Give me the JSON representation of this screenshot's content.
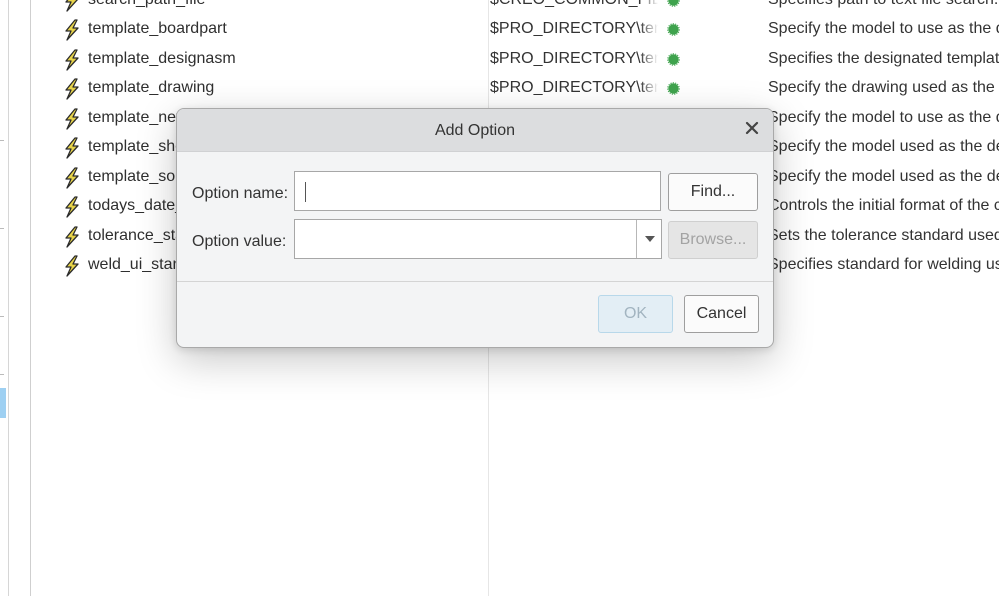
{
  "options_list": {
    "rows": [
      {
        "name": "search_path_file",
        "value": "$CREO_COMMON_FILES",
        "description": "Specifies path to text file search.p"
      },
      {
        "name": "template_boardpart",
        "value": "$PRO_DIRECTORY\\templ",
        "description": "Specify the model to use as the d"
      },
      {
        "name": "template_designasm",
        "value": "$PRO_DIRECTORY\\templ",
        "description": "Specifies the designated template"
      },
      {
        "name": "template_drawing",
        "value": "$PRO_DIRECTORY\\templ",
        "description": "Specify the drawing used as the d"
      },
      {
        "name": "template_new",
        "value": "",
        "description": "Specify the model to use as the d"
      },
      {
        "name": "template_she",
        "value": "",
        "description": "Specify the model used as the def"
      },
      {
        "name": "template_soli",
        "value": "",
        "description": "Specify the model used as the def"
      },
      {
        "name": "todays_date_",
        "value": "",
        "description": "Controls the initial format of the c"
      },
      {
        "name": "tolerance_sta",
        "value": "",
        "description": "Sets the tolerance standard used v"
      },
      {
        "name": "weld_ui_stanc",
        "value": "",
        "description": "Specifies standard for welding use"
      }
    ],
    "row_icon": "lightning-bolt-icon",
    "status_icon": "green-status-dot-icon",
    "status_color": "#3fa34d",
    "icon_color": "#e8d44a"
  },
  "dialog": {
    "title": "Add Option",
    "close_icon": "close-icon",
    "option_name_label": "Option name:",
    "option_name_value": "",
    "option_value_label": "Option value:",
    "option_value_value": "",
    "find_button": "Find...",
    "browse_button": "Browse...",
    "ok_button": "OK",
    "cancel_button": "Cancel"
  }
}
